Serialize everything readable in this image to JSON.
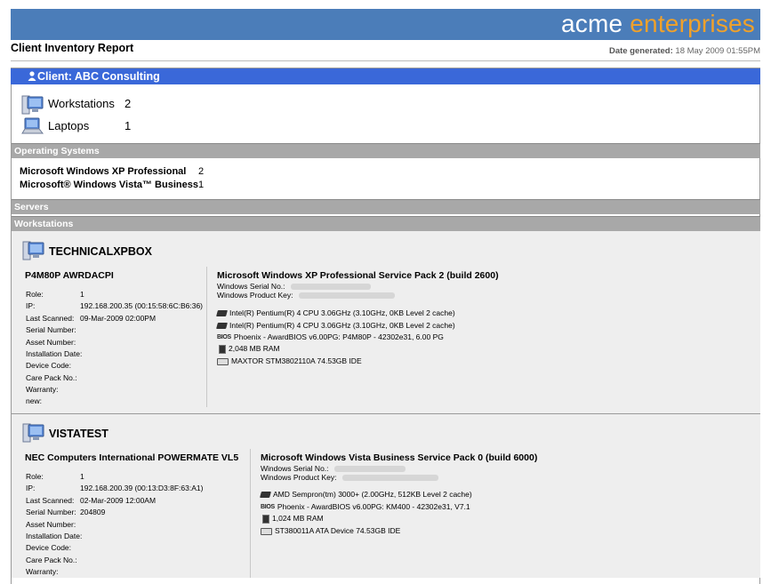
{
  "brand": {
    "part1": "acme ",
    "part2": "enterprises"
  },
  "report": {
    "title": "Client Inventory Report",
    "date_label": "Date generated:",
    "date_value": "18 May 2009 01:55PM"
  },
  "client": {
    "label": "Client: ABC Consulting",
    "counts": [
      {
        "label": "Workstations",
        "value": "2",
        "icon": "workstation-icon"
      },
      {
        "label": "Laptops",
        "value": "1",
        "icon": "laptop-icon"
      }
    ]
  },
  "sections": {
    "os": "Operating Systems",
    "servers": "Servers",
    "workstations": "Workstations"
  },
  "operating_systems": [
    {
      "name": "Microsoft Windows XP Professional",
      "count": "2"
    },
    {
      "name": "Microsoft® Windows Vista™ Business",
      "count": "1"
    }
  ],
  "colors": {
    "banner": "#4b7db9",
    "brand_accent": "#f0a12a",
    "client_bar": "#3a68d9",
    "section_bar": "#a8a8a8",
    "block_bg": "#eeeeee"
  },
  "machines": [
    {
      "name": "TECHNICALXPBOX",
      "model": "P4M80P AWRDACPI",
      "fields": [
        {
          "k": "Role:",
          "v": "1"
        },
        {
          "k": "IP:",
          "v": "192.168.200.35 (00:15:58:6C:B6:36)"
        },
        {
          "k": "Last Scanned:",
          "v": "09-Mar-2009 02:00PM"
        },
        {
          "k": "Serial Number:",
          "v": ""
        },
        {
          "k": "Asset Number:",
          "v": ""
        },
        {
          "k": "Installation Date:",
          "v": ""
        },
        {
          "k": "Device Code:",
          "v": ""
        },
        {
          "k": "Care Pack No.:",
          "v": ""
        },
        {
          "k": "Warranty:",
          "v": ""
        },
        {
          "k": "new:",
          "v": ""
        }
      ],
      "os": "Microsoft Windows XP Professional Service Pack 2 (build 2600)",
      "serial_label": "Windows Serial No.:",
      "key_label": "Windows Product Key:",
      "hardware": [
        {
          "icon": "cpu-icon",
          "text": "Intel(R) Pentium(R) 4 CPU 3.06GHz (3.10GHz, 0KB Level 2 cache)"
        },
        {
          "icon": "cpu-icon",
          "text": "Intel(R) Pentium(R) 4 CPU 3.06GHz (3.10GHz, 0KB Level 2 cache)"
        },
        {
          "icon": "bios-icon",
          "text": "Phoenix - AwardBIOS v6.00PG: P4M80P - 42302e31, 6.00 PG"
        },
        {
          "icon": "ram-icon",
          "text": "2,048 MB RAM"
        },
        {
          "icon": "hdd-icon",
          "text": "MAXTOR STM3802110A 74.53GB IDE"
        }
      ]
    },
    {
      "name": "VISTATEST",
      "model": "NEC Computers International POWERMATE VL5",
      "fields": [
        {
          "k": "Role:",
          "v": "1"
        },
        {
          "k": "IP:",
          "v": "192.168.200.39 (00:13:D3:8F:63:A1)"
        },
        {
          "k": "Last Scanned:",
          "v": "02-Mar-2009 12:00AM"
        },
        {
          "k": "Serial Number:",
          "v": "204809"
        },
        {
          "k": "Asset Number:",
          "v": ""
        },
        {
          "k": "Installation Date:",
          "v": ""
        },
        {
          "k": "Device Code:",
          "v": ""
        },
        {
          "k": "Care Pack No.:",
          "v": ""
        },
        {
          "k": "Warranty:",
          "v": ""
        }
      ],
      "os": "Microsoft Windows Vista Business Service Pack 0 (build 6000)",
      "serial_label": "Windows Serial No.:",
      "key_label": "Windows Product Key:",
      "hardware": [
        {
          "icon": "cpu-icon",
          "text": "AMD Sempron(tm) 3000+ (2.00GHz, 512KB Level 2 cache)"
        },
        {
          "icon": "bios-icon",
          "text": "Phoenix - AwardBIOS v6.00PG: KM400 - 42302e31, V7.1"
        },
        {
          "icon": "ram-icon",
          "text": "1,024 MB RAM"
        },
        {
          "icon": "hdd-icon",
          "text": "ST380011A ATA Device 74.53GB IDE"
        }
      ]
    }
  ]
}
